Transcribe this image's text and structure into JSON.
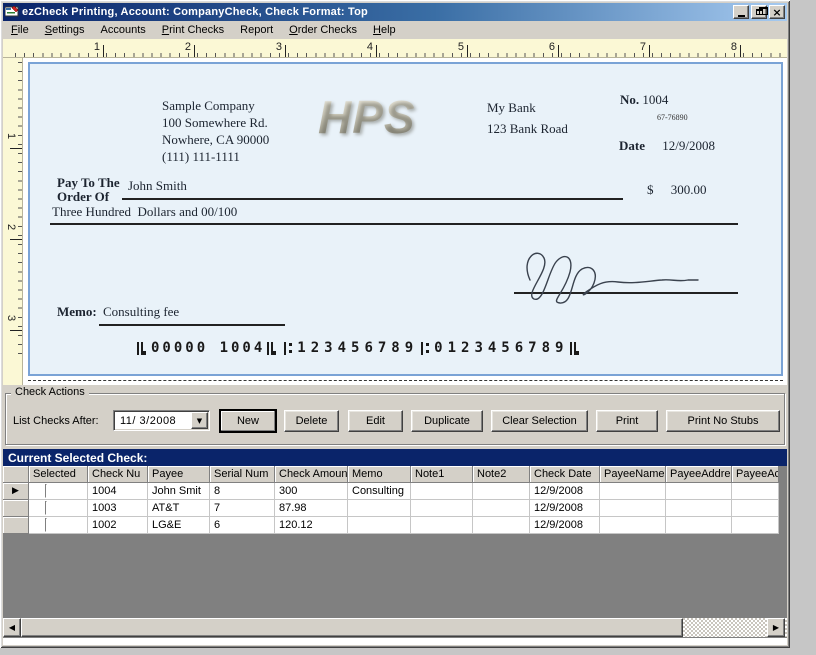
{
  "window": {
    "title": "ezCheck Printing, Account: CompanyCheck, Check Format: Top"
  },
  "icons": {
    "close": "×",
    "dropdown": "▼",
    "row_pointer": "▶",
    "scroll_left": "◀",
    "scroll_right": "▶"
  },
  "menu": {
    "items": [
      "File",
      "Settings",
      "Accounts",
      "Print Checks",
      "Report",
      "Order Checks",
      "Help"
    ]
  },
  "ruler": {
    "h": [
      "1",
      "2",
      "3",
      "4",
      "5",
      "6",
      "7",
      "8"
    ],
    "v": [
      "1",
      "2",
      "3"
    ]
  },
  "check": {
    "company": [
      "Sample Company",
      "100 Somewhere Rd.",
      "Nowhere, CA 90000",
      "(111) 111-1111"
    ],
    "watermark": "HPS",
    "bank": [
      "My Bank",
      "123 Bank Road"
    ],
    "no_label": "No.",
    "check_number": "1004",
    "fraction": "67-76890",
    "date_label": "Date",
    "date": "12/9/2008",
    "payto_line1": "Pay To The",
    "payto_line2": "Order Of",
    "payee": "John Smith",
    "dollar_sign": "$",
    "amount": "300.00",
    "amount_words": "Three Hundred  Dollars and 00/100",
    "memo_label": "Memo:",
    "memo": "Consulting fee",
    "micr": {
      "check_segment": "00000 1004",
      "routing": "123456789",
      "account": "0123456789"
    }
  },
  "actions": {
    "group_label": "Check Actions",
    "list_after_label": "List Checks After:",
    "date_value": "11/ 3/2008",
    "buttons": [
      "New",
      "Delete",
      "Edit",
      "Duplicate",
      "Clear Selection",
      "Print",
      "Print No Stubs"
    ]
  },
  "selected_bar": {
    "label": "Current Selected Check:"
  },
  "grid": {
    "columns": [
      "",
      "Selected",
      "Check Nu",
      "Payee",
      "Serial Num",
      "Check Amount",
      "Memo",
      "Note1",
      "Note2",
      "Check Date",
      "PayeeName",
      "PayeeAddre",
      "PayeeAc"
    ],
    "rows": [
      {
        "check_num": "1004",
        "payee": "John Smit",
        "serial": "8",
        "amount": "300",
        "memo": "Consulting",
        "note1": "",
        "note2": "",
        "date": "12/9/2008",
        "payee_name": "",
        "payee_addre": "",
        "payee_ac": ""
      },
      {
        "check_num": "1003",
        "payee": "AT&T",
        "serial": "7",
        "amount": "87.98",
        "memo": "",
        "note1": "",
        "note2": "",
        "date": "12/9/2008",
        "payee_name": "",
        "payee_addre": "",
        "payee_ac": ""
      },
      {
        "check_num": "1002",
        "payee": "LG&E",
        "serial": "6",
        "amount": "120.12",
        "memo": "",
        "note1": "",
        "note2": "",
        "date": "12/9/2008",
        "payee_name": "",
        "payee_addre": "",
        "payee_ac": ""
      }
    ]
  },
  "colors": {
    "titlebar_start": "#0a246a",
    "titlebar_end": "#a6caf0",
    "panel": "#d4d0c8",
    "ruler_bg": "#fbf8d5",
    "check_bg": "#e9f2f9",
    "check_border": "#7aa3d6",
    "navy_bar": "#0a246a",
    "grid_empty": "#808080"
  }
}
